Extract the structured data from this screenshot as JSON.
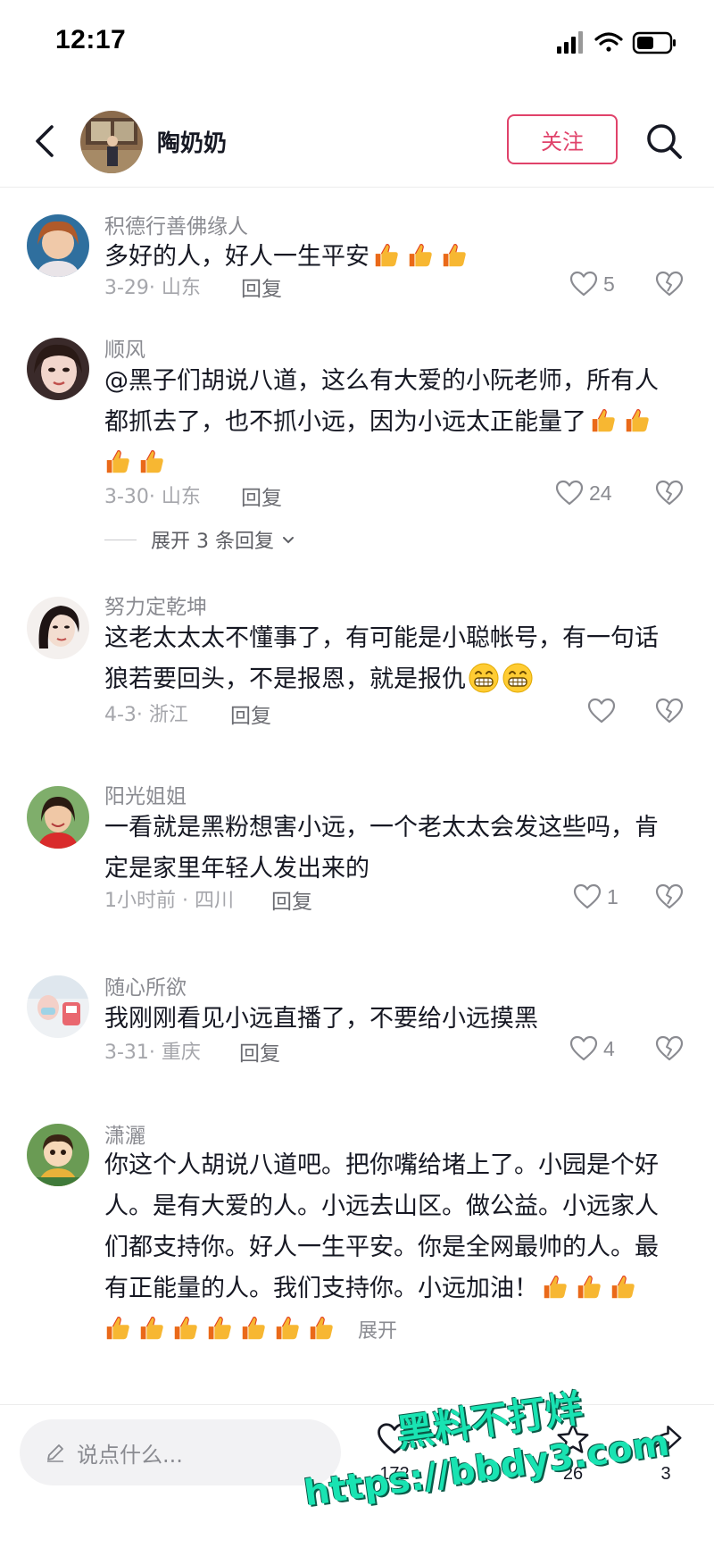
{
  "status_bar": {
    "time": "12:17",
    "icons": [
      "signal-icon",
      "wifi-icon",
      "battery-icon"
    ]
  },
  "header": {
    "back_icon": "chevron-left-icon",
    "name": "陶奶奶",
    "follow_label": "关注",
    "search_icon": "search-icon"
  },
  "comments": [
    {
      "user": "积德行善佛缘人",
      "text": "多好的人，好人一生平安",
      "emoji": [
        "thumbs-up",
        "thumbs-up",
        "thumbs-up"
      ],
      "meta": "3-29· 山东",
      "reply_label": "回复",
      "likes": "5"
    },
    {
      "user": "顺风",
      "text_line1": "@黑子们胡说八道，这么有大爱的小阮老师，所有人",
      "text_line2": "都抓去了，也不抓小远，因为小远太正能量了",
      "emoji": [
        "thumbs-up",
        "thumbs-up",
        "thumbs-up",
        "thumbs-up"
      ],
      "meta": "3-30· 山东",
      "reply_label": "回复",
      "likes": "24",
      "expand_label": "展开 3 条回复"
    },
    {
      "user": "努力定乾坤",
      "text_line1": "这老太太太不懂事了，有可能是小聪帐号，有一句话",
      "text_line2": "狼若要回头，不是报恩，就是报仇",
      "emoji": [
        "grinning-face",
        "grinning-face"
      ],
      "meta": "4-3· 浙江",
      "reply_label": "回复",
      "likes": ""
    },
    {
      "user": "阳光姐姐",
      "text_line1": "一看就是黑粉想害小远，一个老太太会发这些吗，肯",
      "text_line2": "定是家里年轻人发出来的",
      "meta": "1小时前 · 四川",
      "reply_label": "回复",
      "likes": "1"
    },
    {
      "user": "随心所欲",
      "text": "我刚刚看见小远直播了，不要给小远摸黑",
      "meta": "3-31· 重庆",
      "reply_label": "回复",
      "likes": "4"
    },
    {
      "user": "潇灑",
      "text_line1": "你这个人胡说八道吧。把你嘴给堵上了。小园是个好",
      "text_line2": "人。是有大爱的人。小远去山区。做公益。小远家人",
      "text_line3": "们都支持你。好人一生平安。你是全网最帅的人。最",
      "text_line4": "有正能量的人。我们支持你。小远加油！",
      "expand_label": "展开"
    }
  ],
  "bottom_bar": {
    "input_placeholder": "说点什么...",
    "edit_icon": "pencil-icon",
    "like_count": "172",
    "star_count": "26",
    "share_count": "3"
  },
  "watermark": {
    "line1": "黑料不打烊",
    "line2": "https://bbdy3.com"
  },
  "colors": {
    "accent": "#e0426a",
    "watermark": "#19e3b2"
  }
}
